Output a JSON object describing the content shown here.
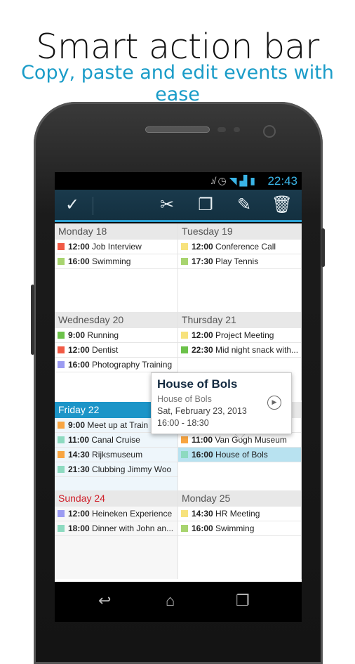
{
  "promo": {
    "title": "Smart action bar",
    "subtitle": "Copy, paste and edit events with ease"
  },
  "status": {
    "time": "22:43",
    "icons": [
      "mute-icon",
      "alarm-icon",
      "wifi-icon",
      "signal-icon",
      "battery-icon"
    ]
  },
  "actionbar": {
    "icons": [
      "check-icon",
      "cut-icon",
      "copy-icon",
      "edit-icon",
      "delete-icon"
    ],
    "accent": "#2b9fd0"
  },
  "colors": {
    "red": "#f15a45",
    "lime": "#a8d46f",
    "yellow": "#f7e27c",
    "green": "#6cc24a",
    "lavender": "#9b9bf2",
    "orange": "#f8a541",
    "teal": "#8ddac0",
    "today": "#1c95c8",
    "sunday": "#d0202a",
    "selected": "#b8e2f0"
  },
  "days": [
    {
      "label": "Monday 18",
      "events": [
        {
          "time": "12:00",
          "title": "Job Interview",
          "color": "red"
        },
        {
          "time": "16:00",
          "title": "Swimming",
          "color": "lime"
        }
      ]
    },
    {
      "label": "Tuesday 19",
      "events": [
        {
          "time": "12:00",
          "title": "Conference Call",
          "color": "yellow"
        },
        {
          "time": "17:30",
          "title": "Play Tennis",
          "color": "lime"
        }
      ]
    },
    {
      "label": "Wednesday 20",
      "events": [
        {
          "time": "9:00",
          "title": "Running",
          "color": "green"
        },
        {
          "time": "12:00",
          "title": "Dentist",
          "color": "red"
        },
        {
          "time": "16:00",
          "title": "Photography Training",
          "color": "lavender"
        }
      ]
    },
    {
      "label": "Thursday 21",
      "events": [
        {
          "time": "12:00",
          "title": "Project Meeting",
          "color": "yellow"
        },
        {
          "time": "22:30",
          "title": "Mid night snack with...",
          "color": "green"
        }
      ]
    },
    {
      "label": "Friday 22",
      "today": true,
      "events": [
        {
          "time": "9:00",
          "title": "Meet up at Train S",
          "color": "orange"
        },
        {
          "time": "11:00",
          "title": "Canal Cruise",
          "color": "teal"
        },
        {
          "time": "14:30",
          "title": "Rijksmuseum",
          "color": "orange"
        },
        {
          "time": "21:30",
          "title": "Clubbing Jimmy Woo",
          "color": "teal"
        }
      ]
    },
    {
      "label": "",
      "events": [
        {
          "time": "",
          "title": "",
          "color": ""
        },
        {
          "time": "11:00",
          "title": "Van Gogh Museum",
          "color": "orange"
        },
        {
          "time": "16:00",
          "title": "House of Bols",
          "color": "teal",
          "selected": true
        }
      ]
    },
    {
      "label": "Sunday 24",
      "sunday": true,
      "events": [
        {
          "time": "12:00",
          "title": "Heineken Experience",
          "color": "lavender"
        },
        {
          "time": "18:00",
          "title": "Dinner with John an...",
          "color": "teal"
        }
      ]
    },
    {
      "label": "Monday 25",
      "events": [
        {
          "time": "14:30",
          "title": "HR Meeting",
          "color": "yellow"
        },
        {
          "time": "16:00",
          "title": "Swimming",
          "color": "lime"
        }
      ]
    }
  ],
  "popup": {
    "title": "House of Bols",
    "location": "House of Bols",
    "date": "Sat, February 23, 2013",
    "time": "16:00 - 18:30"
  }
}
